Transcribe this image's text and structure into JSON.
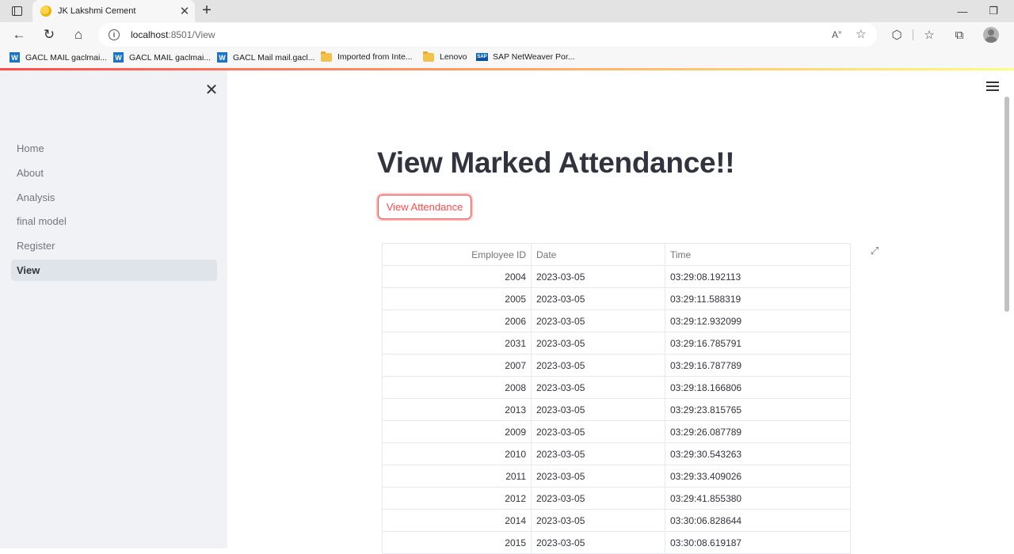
{
  "browser": {
    "tab_title": "JK Lakshmi Cement",
    "url_host": "localhost",
    "url_rest": ":8501/View",
    "read_aloud": "A",
    "bookmarks": [
      {
        "icon": "w-icon",
        "label": "GACL MAIL gaclmai..."
      },
      {
        "icon": "w-icon",
        "label": "GACL MAIL gaclmai..."
      },
      {
        "icon": "w-icon",
        "label": "GACL Mail mail.gacl..."
      },
      {
        "icon": "folder-icon",
        "label": "Imported from Inte..."
      },
      {
        "icon": "folder-icon",
        "label": "Lenovo"
      },
      {
        "icon": "sap-icon",
        "label": "SAP NetWeaver Por..."
      }
    ]
  },
  "sidebar": {
    "items": [
      {
        "label": "Home",
        "active": false
      },
      {
        "label": "About",
        "active": false
      },
      {
        "label": "Analysis",
        "active": false
      },
      {
        "label": "final model",
        "active": false
      },
      {
        "label": "Register",
        "active": false
      },
      {
        "label": "View",
        "active": true
      }
    ]
  },
  "main": {
    "title": "View Marked Attendance!!",
    "button_label": "View Attendance"
  },
  "table": {
    "headers": [
      "Employee ID",
      "Date",
      "Time"
    ],
    "rows": [
      [
        "2004",
        "2023-03-05",
        "03:29:08.192113"
      ],
      [
        "2005",
        "2023-03-05",
        "03:29:11.588319"
      ],
      [
        "2006",
        "2023-03-05",
        "03:29:12.932099"
      ],
      [
        "2031",
        "2023-03-05",
        "03:29:16.785791"
      ],
      [
        "2007",
        "2023-03-05",
        "03:29:16.787789"
      ],
      [
        "2008",
        "2023-03-05",
        "03:29:18.166806"
      ],
      [
        "2013",
        "2023-03-05",
        "03:29:23.815765"
      ],
      [
        "2009",
        "2023-03-05",
        "03:29:26.087789"
      ],
      [
        "2010",
        "2023-03-05",
        "03:29:30.543263"
      ],
      [
        "2011",
        "2023-03-05",
        "03:29:33.409026"
      ],
      [
        "2012",
        "2023-03-05",
        "03:29:41.855380"
      ],
      [
        "2014",
        "2023-03-05",
        "03:30:06.828644"
      ],
      [
        "2015",
        "2023-03-05",
        "03:30:08.619187"
      ]
    ]
  },
  "colors": {
    "accent": "#ff4b4b",
    "sidebar_bg": "#f0f2f6",
    "text": "#31333f"
  }
}
